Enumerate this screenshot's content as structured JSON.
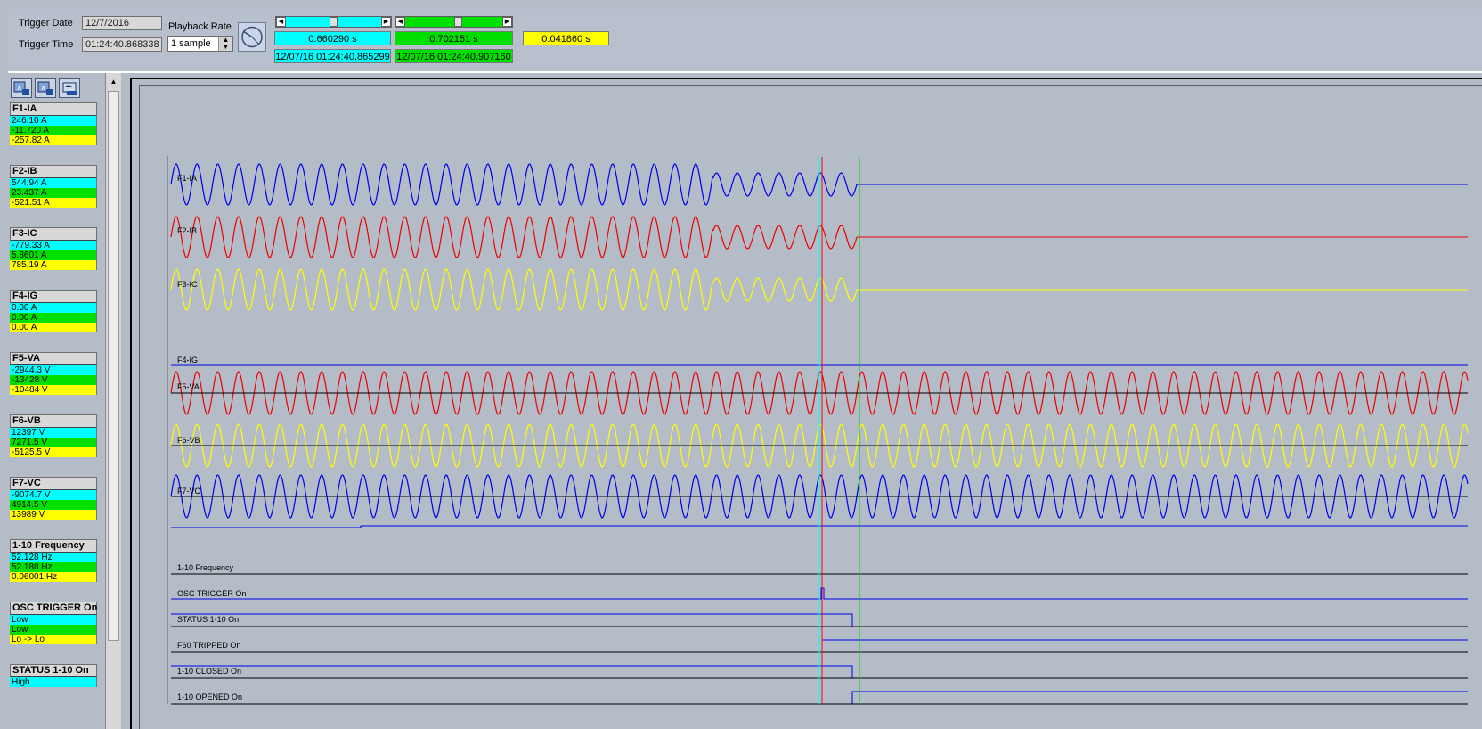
{
  "header": {
    "trigger_date_label": "Trigger Date",
    "trigger_date_value": "12/7/2016",
    "trigger_time_label": "Trigger Time",
    "trigger_time_value": "01:24:40.868338",
    "playback_rate_label": "Playback Rate",
    "playback_rate_value": "1 sample",
    "cursor1_time": "0.660290 s",
    "cursor1_timestamp": "12/07/16 01:24:40.865299",
    "cursor2_time": "0.702151 s",
    "cursor2_timestamp": "12/07/16 01:24:40.907160",
    "delta_time": "0.041860 s"
  },
  "colors": {
    "cursor1": "#00ffff",
    "cursor2": "#00e000",
    "delta": "#ffff00",
    "blue_trace": "#0000ee",
    "red_trace": "#ee0000",
    "yellow_trace": "#ffff00",
    "trigger_line": "#ff0000"
  },
  "channels": [
    {
      "name": "F1-IA",
      "c1": "246.10 A",
      "c2": "-11.720 A",
      "d": "-257.82 A"
    },
    {
      "name": "F2-IB",
      "c1": "544.94 A",
      "c2": "23.437 A",
      "d": "-521.51 A"
    },
    {
      "name": "F3-IC",
      "c1": "-779.33 A",
      "c2": "5.8601 A",
      "d": "785.19 A"
    },
    {
      "name": "F4-IG",
      "c1": "0.00 A",
      "c2": "0.00 A",
      "d": "0.00 A"
    },
    {
      "name": "F5-VA",
      "c1": "-2944.3 V",
      "c2": "-13428 V",
      "d": "-10484 V"
    },
    {
      "name": "F6-VB",
      "c1": "12397 V",
      "c2": "7271.5 V",
      "d": "-5125.5 V"
    },
    {
      "name": "F7-VC",
      "c1": "-9074.7 V",
      "c2": "4914.5 V",
      "d": "13989 V"
    },
    {
      "name": "1-10  Frequency",
      "c1": "52.128 Hz",
      "c2": "52.188 Hz",
      "d": "0.06001 Hz"
    },
    {
      "name": "OSC TRIGGER  On",
      "c1": "Low",
      "c2": "Low",
      "d": "Lo -> Lo"
    },
    {
      "name": "STATUS 1-10  On",
      "c1": "High",
      "c2": "",
      "d": ""
    }
  ],
  "plot_labels": {
    "ia": "F1-IA",
    "ib": "F2-IB",
    "ic": "F3-IC",
    "ig": "F4-IG",
    "va": "F5-VA",
    "vb": "F6-VB",
    "vc": "F7-VC",
    "freq": "1-10  Frequency",
    "osc": "OSC TRIGGER  On",
    "status": "STATUS 1-10  On",
    "f60": "F60 TRIPPED  On",
    "closed": "1-10 CLOSED  On",
    "opened": "1-10 OPENED  On"
  },
  "icons": [
    "cursor1-tool-icon",
    "cursor2-tool-icon",
    "zoom-tool-icon",
    "playback-dial-icon"
  ]
}
